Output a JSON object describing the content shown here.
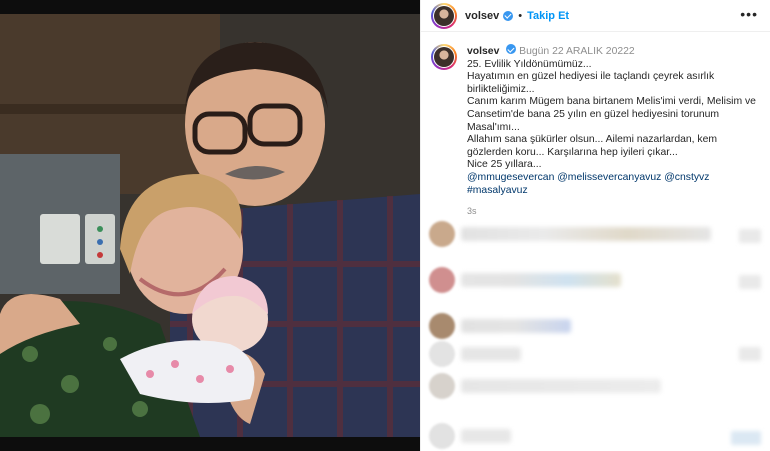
{
  "header": {
    "username": "volsev",
    "separator": "•",
    "follow_label": "Takip Et",
    "more_icon": "more-horizontal-icon"
  },
  "caption": {
    "username": "volsev",
    "date": "Bugün 22 ARALIK 20222",
    "lines": [
      "25. Evlilik Yıldönümümüz...",
      "Hayatımın en güzel hediyesi ile taçlandı çeyrek asırlık birlikteliğimiz...",
      "Canım karım Mügem bana birtanem Melis'imi verdi, Melisim ve Cansetim'de bana 25 yılın en güzel hediyesini torunum Masal'ımı...",
      "Allahım sana şükürler olsun... Ailemi nazarlardan, kem gözlerden koru... Karşılarına hep iyileri çıkar...",
      "Nice 25 yıllara..."
    ],
    "tags": "@mmugesevercan @melissevercanyavuz @cnstyvz #masalyavuz",
    "time": "3s"
  },
  "colors": {
    "accent": "#0095f6",
    "verified": "#3897f0",
    "tag_link": "#00376b"
  }
}
